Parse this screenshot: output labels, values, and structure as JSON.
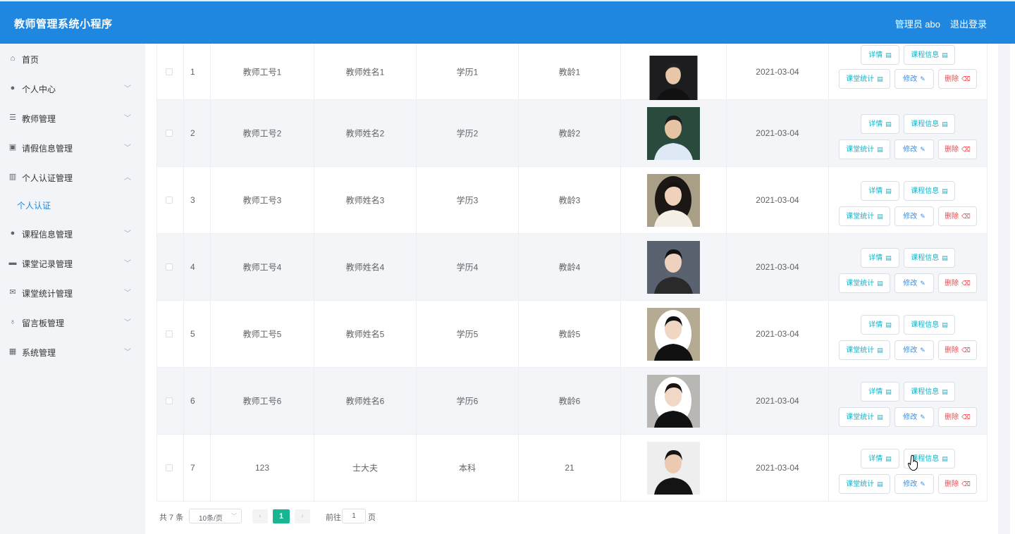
{
  "header": {
    "title": "教师管理系统小程序",
    "user": "管理员 abo",
    "logout": "退出登录"
  },
  "sidebar": {
    "items": [
      {
        "label": "首页",
        "icon": "home-icon",
        "glyph": "⌂",
        "arrow": ""
      },
      {
        "label": "个人中心",
        "icon": "user-icon",
        "glyph": "●",
        "arrow": "﹀"
      },
      {
        "label": "教师管理",
        "icon": "list-icon",
        "glyph": "☰",
        "arrow": "﹀"
      },
      {
        "label": "请假信息管理",
        "icon": "clipboard-icon",
        "glyph": "▣",
        "arrow": "﹀"
      },
      {
        "label": "个人认证管理",
        "icon": "books-icon",
        "glyph": "▥",
        "arrow": "︿"
      },
      {
        "label": "个人认证",
        "icon": "",
        "glyph": "",
        "arrow": ""
      },
      {
        "label": "课程信息管理",
        "icon": "user-icon",
        "glyph": "●",
        "arrow": "﹀"
      },
      {
        "label": "课堂记录管理",
        "icon": "monitor-icon",
        "glyph": "▬",
        "arrow": "﹀"
      },
      {
        "label": "课堂统计管理",
        "icon": "mail-icon",
        "glyph": "✉",
        "arrow": "﹀"
      },
      {
        "label": "留言板管理",
        "icon": "microphone-icon",
        "glyph": "♁",
        "arrow": "﹀"
      },
      {
        "label": "系统管理",
        "icon": "grid-icon",
        "glyph": "▦",
        "arrow": "﹀"
      }
    ]
  },
  "table": {
    "rows": [
      {
        "index": "1",
        "no": "教师工号1",
        "name": "教师姓名1",
        "edu": "学历1",
        "age": "教龄1",
        "date": "2021-03-04"
      },
      {
        "index": "2",
        "no": "教师工号2",
        "name": "教师姓名2",
        "edu": "学历2",
        "age": "教龄2",
        "date": "2021-03-04"
      },
      {
        "index": "3",
        "no": "教师工号3",
        "name": "教师姓名3",
        "edu": "学历3",
        "age": "教龄3",
        "date": "2021-03-04"
      },
      {
        "index": "4",
        "no": "教师工号4",
        "name": "教师姓名4",
        "edu": "学历4",
        "age": "教龄4",
        "date": "2021-03-04"
      },
      {
        "index": "5",
        "no": "教师工号5",
        "name": "教师姓名5",
        "edu": "学历5",
        "age": "教龄5",
        "date": "2021-03-04"
      },
      {
        "index": "6",
        "no": "教师工号6",
        "name": "教师姓名6",
        "edu": "学历6",
        "age": "教龄6",
        "date": "2021-03-04"
      },
      {
        "index": "7",
        "no": "123",
        "name": "士大夫",
        "edu": "本科",
        "age": "21",
        "date": "2021-03-04"
      }
    ],
    "buttons": {
      "detail": "详情",
      "course": "课程信息",
      "stat": "课堂统计",
      "edit": "修改",
      "delete": "删除"
    }
  },
  "pager": {
    "total": "共 7 条",
    "size": "10条/页",
    "current": "1",
    "goto": "前往",
    "goto_value": "1",
    "page_unit": "页",
    "prev": "‹",
    "next": "›"
  }
}
